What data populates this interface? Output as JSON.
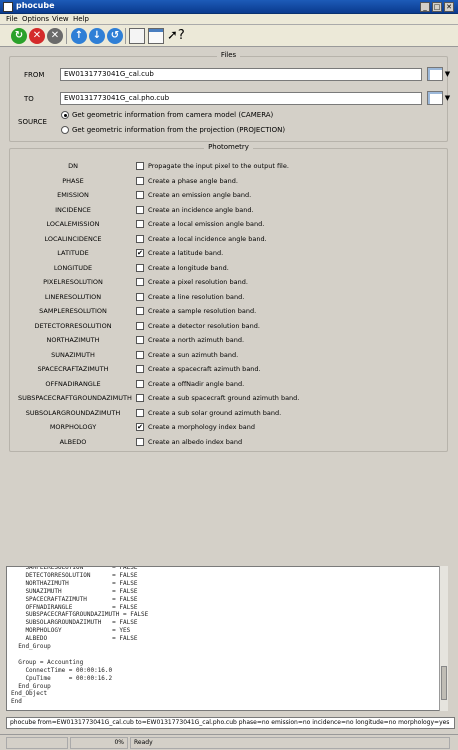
{
  "window": {
    "title": "phocube",
    "minimize_glyph": "_",
    "maximize_glyph": "□",
    "close_glyph": "✕"
  },
  "menu": [
    "File",
    "Options",
    "View",
    "Help"
  ],
  "toolbar": {
    "icons": [
      "run-icon",
      "stop-icon",
      "cancel-icon",
      "arrow-up-icon",
      "arrow-down-icon",
      "reset-icon",
      "save-icon",
      "history-icon",
      "whats-this-icon"
    ],
    "colors": {
      "run": "#2aa12a",
      "stop": "#d42a2a",
      "cancel": "#6a6a6a",
      "nav": "#2f7fd6"
    }
  },
  "files": {
    "title": "Files",
    "from_label": "FROM",
    "from_value": "EW0131773041G_cal.cub",
    "to_label": "TO",
    "to_value": "EW0131773041G_cal.pho.cub",
    "source_label": "SOURCE",
    "source_options": [
      "Get geometric information from camera model (CAMERA)",
      "Get geometric information from the projection (PROJECTION)"
    ],
    "source_selected": 0
  },
  "photometry": {
    "title": "Photometry",
    "rows": [
      {
        "name": "DN",
        "desc": "Propagate the input pixel to the output file.",
        "checked": false
      },
      {
        "name": "PHASE",
        "desc": "Create a phase angle band.",
        "checked": false
      },
      {
        "name": "EMISSION",
        "desc": "Create an emission angle band.",
        "checked": false
      },
      {
        "name": "INCIDENCE",
        "desc": "Create an incidence angle band.",
        "checked": false
      },
      {
        "name": "LOCALEMISSION",
        "desc": "Create a local emission angle band.",
        "checked": false
      },
      {
        "name": "LOCALINCIDENCE",
        "desc": "Create a local incidence angle band.",
        "checked": false
      },
      {
        "name": "LATITUDE",
        "desc": "Create a latitude band.",
        "checked": true
      },
      {
        "name": "LONGITUDE",
        "desc": "Create a longitude band.",
        "checked": false
      },
      {
        "name": "PIXELRESOLUTION",
        "desc": "Create a pixel resolution band.",
        "checked": false
      },
      {
        "name": "LINERESOLUTION",
        "desc": "Create a line resolution band.",
        "checked": false
      },
      {
        "name": "SAMPLERESOLUTION",
        "desc": "Create a sample resolution band.",
        "checked": false
      },
      {
        "name": "DETECTORRESOLUTION",
        "desc": "Create a detector resolution band.",
        "checked": false
      },
      {
        "name": "NORTHAZIMUTH",
        "desc": "Create a north azimuth band.",
        "checked": false
      },
      {
        "name": "SUNAZIMUTH",
        "desc": "Create a sun azimuth band.",
        "checked": false
      },
      {
        "name": "SPACECRAFTAZIMUTH",
        "desc": "Create a spacecraft azimuth band.",
        "checked": false
      },
      {
        "name": "OFFNADIRANGLE",
        "desc": "Create a offNadir angle band.",
        "checked": false
      },
      {
        "name": "SUBSPACECRAFTGROUNDAZIMUTH",
        "desc": "Create a sub spacecraft ground azimuth band.",
        "checked": false
      },
      {
        "name": "SUBSOLARGROUNDAZIMUTH",
        "desc": "Create a sub solar ground azimuth band.",
        "checked": false
      },
      {
        "name": "MORPHOLOGY",
        "desc": "Create a morphology index band",
        "checked": true
      },
      {
        "name": "ALBEDO",
        "desc": "Create an albedo index band",
        "checked": false
      }
    ]
  },
  "log": [
    "    SAMPLERESOLUTION        = FALSE",
    "    DETECTORRESOLUTION      = FALSE",
    "    NORTHAZIMUTH            = FALSE",
    "    SUNAZIMUTH              = FALSE",
    "    SPACECRAFTAZIMUTH       = FALSE",
    "    OFFNADIRANGLE           = FALSE",
    "    SUBSPACECRAFTGROUNDAZIMUTH = FALSE",
    "    SUBSOLARGROUNDAZIMUTH   = FALSE",
    "    MORPHOLOGY              = YES",
    "    ALBEDO                  = FALSE",
    "  End_Group",
    "",
    "  Group = Accounting",
    "    ConnectTime = 00:00:16.0",
    "    CpuTime     = 00:00:16.2",
    "  End_Group",
    "End_Object",
    "End"
  ],
  "command": "phocube from=EW0131773041G_cal.cub to=EW0131773041G_cal.pho.cub phase=no emission=no incidence=no longitude=no morphology=yes",
  "status": {
    "progress_text": "0%",
    "state_text": "Ready"
  }
}
